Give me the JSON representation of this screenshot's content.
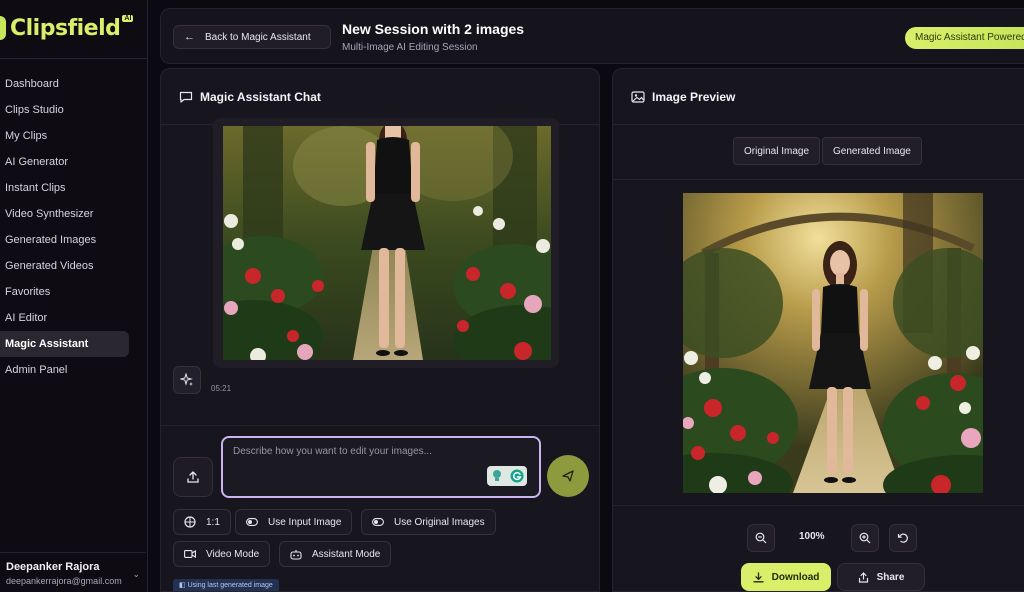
{
  "brand": {
    "name": "Clipsfield",
    "badge": "AI"
  },
  "sidebar": {
    "items": [
      {
        "label": "Dashboard"
      },
      {
        "label": "Clips Studio"
      },
      {
        "label": "My Clips"
      },
      {
        "label": "AI Generator"
      },
      {
        "label": "Instant Clips"
      },
      {
        "label": "Video Synthesizer"
      },
      {
        "label": "Generated Images"
      },
      {
        "label": "Generated Videos"
      },
      {
        "label": "Favorites"
      },
      {
        "label": "AI Editor"
      },
      {
        "label": "Magic Assistant",
        "active": true
      },
      {
        "label": "Admin Panel"
      }
    ],
    "user": {
      "name": "Deepanker Rajora",
      "email": "deepankerrajora@gmail.com"
    }
  },
  "header": {
    "back_label": "Back to Magic Assistant",
    "title": "New Session with 2 images",
    "subtitle": "Multi-Image AI Editing Session",
    "powered_label": "Magic Assistant Powered"
  },
  "chat": {
    "title": "Magic Assistant Chat",
    "message_time": "05:21",
    "prompt_placeholder": "Describe how you want to edit your images...",
    "options": {
      "ratio": "1:1",
      "use_input": "Use Input Image",
      "use_original": "Use Original Images",
      "video_mode": "Video Mode",
      "assistant_mode": "Assistant Mode"
    },
    "hint": "Using last generated image"
  },
  "preview": {
    "title": "Image Preview",
    "tab_original": "Original Image",
    "tab_generated": "Generated Image",
    "zoom": "100%",
    "download_label": "Download",
    "share_label": "Share"
  },
  "colors": {
    "accent": "#d9ef6a",
    "prompt_border": "#c9b6f0",
    "send": "#8e9a3e"
  }
}
